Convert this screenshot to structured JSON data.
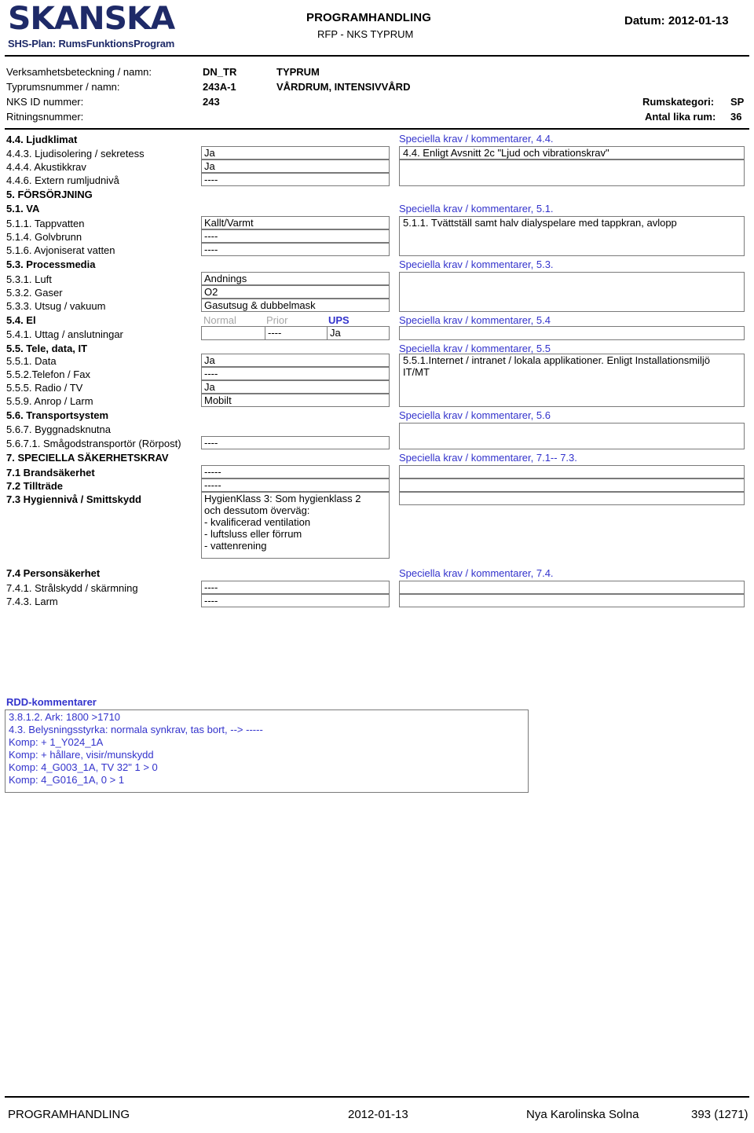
{
  "header": {
    "logo": "SKANSKA",
    "subtitle": "SHS-Plan: RumsFunktionsProgram",
    "doc_type": "PROGRAMHANDLING",
    "doc_ref": "RFP -  NKS TYPRUM",
    "date_label": "Datum: 2012-01-13"
  },
  "meta": {
    "rows": [
      {
        "label": "Verksamhetsbeteckning / namn:",
        "code": "DN_TR",
        "name": "TYPRUM"
      },
      {
        "label": "Typrumsnummer / namn:",
        "code": "243A-1",
        "name": "VÅRDRUM, INTENSIVVÅRD"
      },
      {
        "label": "NKS ID nummer:",
        "code": "243",
        "name": ""
      },
      {
        "label": "Ritningsnummer:",
        "code": "",
        "name": ""
      }
    ],
    "right": [
      {
        "label": "Rumskategori:",
        "value": "SP"
      },
      {
        "label": "Antal lika rum:",
        "value": "36"
      }
    ]
  },
  "rows": {
    "r_44": {
      "label": "4.4. Ljudklimat"
    },
    "r_443": {
      "label": "4.4.3. Ljudisolering / sekretess",
      "value": "Ja"
    },
    "r_444": {
      "label": "4.4.4. Akustikkrav",
      "value": "Ja"
    },
    "r_446": {
      "label": "4.4.6. Extern rumljudnivå",
      "value": "----"
    },
    "r_5": {
      "label": "5. FÖRSÖRJNING"
    },
    "r_51": {
      "label": "5.1. VA"
    },
    "r_511": {
      "label": "5.1.1. Tappvatten",
      "value": "Kallt/Varmt"
    },
    "r_514": {
      "label": "5.1.4. Golvbrunn",
      "value": "----"
    },
    "r_516": {
      "label": "5.1.6. Avjoniserat vatten",
      "value": "----"
    },
    "r_53": {
      "label": "5.3. Processmedia"
    },
    "r_531": {
      "label": "5.3.1. Luft",
      "value": "Andnings"
    },
    "r_532": {
      "label": "5.3.2. Gaser",
      "value": "O2"
    },
    "r_533": {
      "label": "5.3.3. Utsug / vakuum",
      "value": "Gasutsug & dubbelmask"
    },
    "r_54": {
      "label": "5.4. El",
      "col_normal": "Normal",
      "col_prior": "Prior",
      "col_ups": "UPS"
    },
    "r_541": {
      "label": "5.4.1. Uttag / anslutningar",
      "v_normal": "",
      "v_prior": "----",
      "v_ups": "Ja"
    },
    "r_55": {
      "label": "5.5. Tele, data, IT"
    },
    "r_551": {
      "label": "5.5.1. Data",
      "value": "Ja"
    },
    "r_552": {
      "label": "5.5.2.Telefon / Fax",
      "value": "----"
    },
    "r_555": {
      "label": "5.5.5. Radio / TV",
      "value": "Ja"
    },
    "r_559": {
      "label": "5.5.9. Anrop / Larm",
      "value": "Mobilt"
    },
    "r_56": {
      "label": "5.6. Transportsystem"
    },
    "r_567": {
      "label": "5.6.7. Byggnadsknutna"
    },
    "r_5671": {
      "label": "5.6.7.1. Smågodstransportör (Rörpost)",
      "value": "----"
    },
    "r_7": {
      "label": "7. SPECIELLA SÄKERHETSKRAV"
    },
    "r_71": {
      "label": "7.1 Brandsäkerhet",
      "value": "-----"
    },
    "r_72": {
      "label": "7.2 Tillträde",
      "value": "-----"
    },
    "r_73": {
      "label": "7.3 Hygiennivå / Smittskydd",
      "value": "HygienKlass 3: Som hygienklass 2\noch dessutom överväg:\n- kvalificerad ventilation\n- luftsluss eller förrum\n- vattenrening"
    },
    "r_74": {
      "label": "7.4 Personsäkerhet"
    },
    "r_741": {
      "label": "7.4.1. Strålskydd / skärmning",
      "value": "----"
    },
    "r_743": {
      "label": "7.4.3. Larm",
      "value": "----"
    }
  },
  "comments": {
    "c_44": {
      "heading": "Speciella krav / kommentarer, 4.4.",
      "line1": "4.4. Enligt Avsnitt 2c \"Ljud och vibrationskrav\"",
      "body": ""
    },
    "c_51": {
      "heading": "Speciella krav / kommentarer, 5.1.",
      "body": "5.1.1. Tvättställ samt halv dialyspelare med tappkran, avlopp"
    },
    "c_53": {
      "heading": "Speciella krav / kommentarer, 5.3.",
      "body": ""
    },
    "c_54": {
      "heading": "Speciella krav / kommentarer, 5.4",
      "body": ""
    },
    "c_55": {
      "heading": "Speciella krav / kommentarer, 5.5",
      "body": "5.5.1.Internet / intranet / lokala applikationer. Enligt Installationsmiljö\nIT/MT"
    },
    "c_56": {
      "heading": "Speciella krav / kommentarer,  5.6",
      "body": ""
    },
    "c_7": {
      "heading": "Speciella krav / kommentarer, 7.1-- 7.3.",
      "body1": "",
      "body2": "",
      "body3": ""
    },
    "c_74": {
      "heading": "Speciella krav / kommentarer, 7.4.",
      "body1": "",
      "body2": ""
    }
  },
  "rdd": {
    "title": "RDD-kommentarer",
    "body": "3.8.1.2. Ark: 1800 >1710\n4.3. Belysningsstyrka: normala synkrav, tas bort, --> -----\nKomp: + 1_Y024_1A\nKomp: + hållare, visir/munskydd\nKomp: 4_G003_1A, TV 32\" 1 > 0\nKomp: 4_G016_1A, 0 > 1"
  },
  "footer": {
    "left": "PROGRAMHANDLING",
    "date": "2012-01-13",
    "place": "Nya Karolinska Solna",
    "page": "393 (1271)"
  },
  "colors": {
    "brand_navy": "#1e2a68",
    "accent_blue": "#3333cc",
    "muted_gray": "#a6a6a6",
    "box_border": "#7a7a7a"
  }
}
